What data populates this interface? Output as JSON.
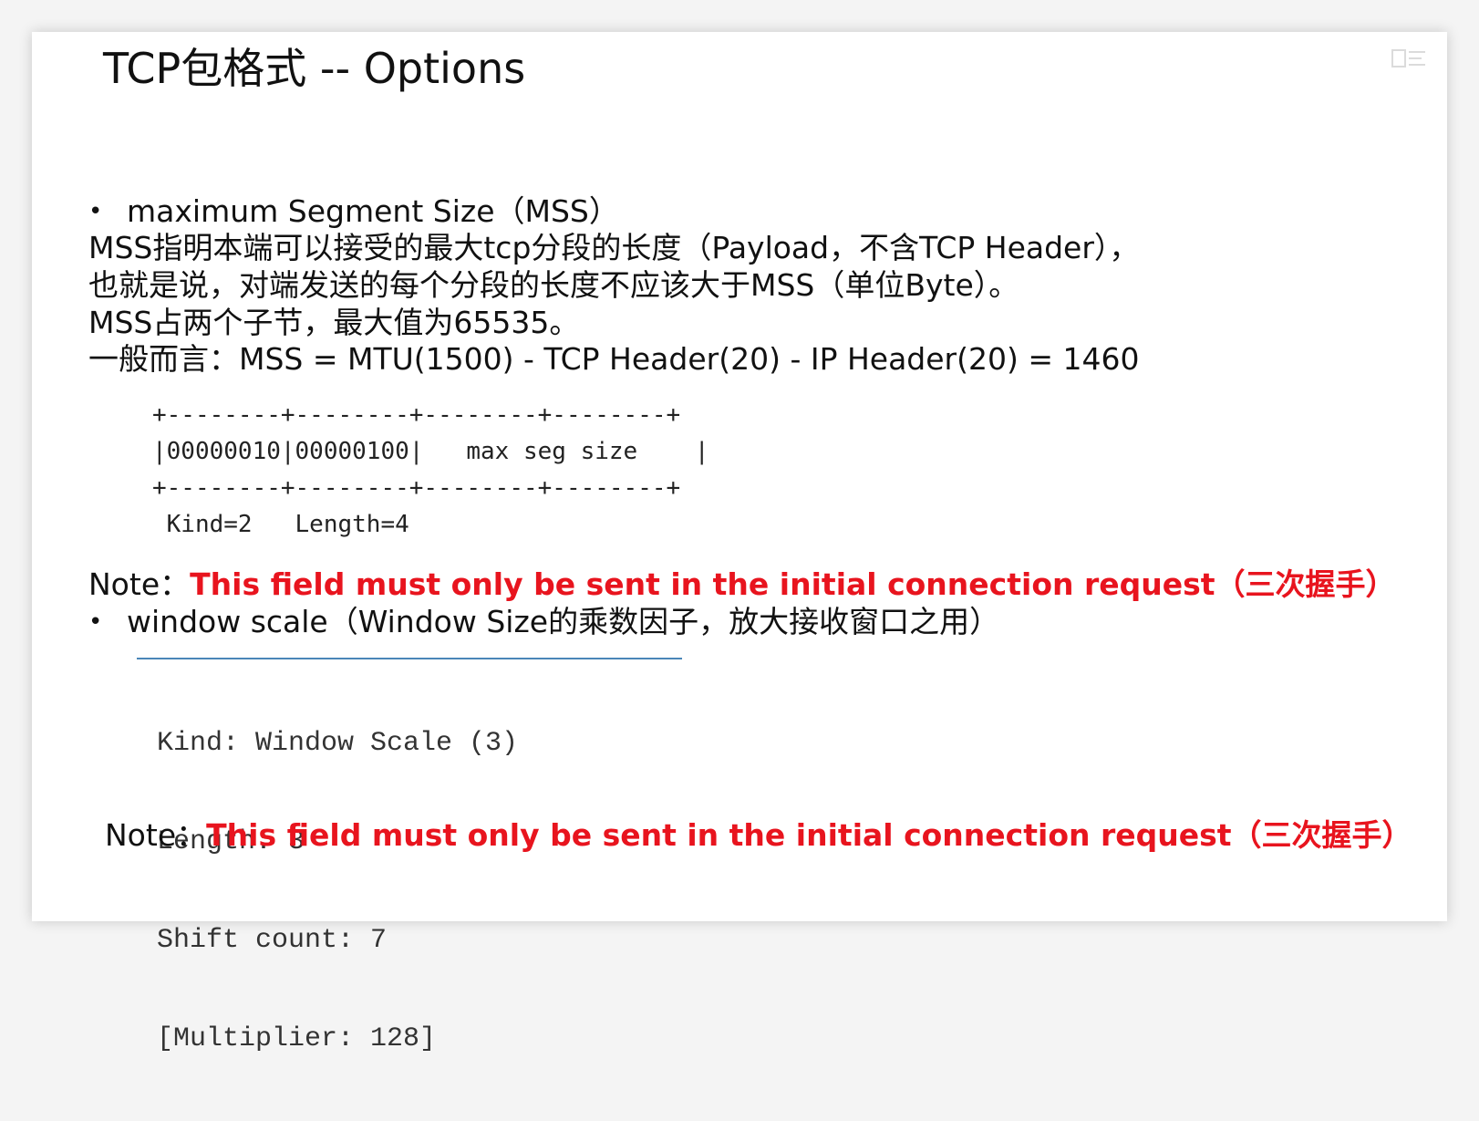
{
  "slide": {
    "title": "TCP包格式 -- Options",
    "mss_section": {
      "bullet": "•",
      "heading": "maximum Segment Size（MSS）",
      "lines": [
        "MSS指明本端可以接受的最大tcp分段的长度（Payload，不含TCP Header），",
        "也就是说，对端发送的每个分段的长度不应该大于MSS（单位Byte）。",
        "MSS占两个子节，最大值为65535。",
        "一般而言：MSS = MTU(1500) - TCP Header(20) - IP Header(20) = 1460"
      ],
      "diagram": {
        "border_top": "+--------+--------+--------+--------+",
        "row": "|00000010|00000100|   max seg size    |",
        "border_bottom": "+--------+--------+--------+--------+",
        "labels": " Kind=2   Length=4"
      },
      "note_prefix": "Note：",
      "note_text": "This field must only be sent in the initial connection request（三次握手）"
    },
    "ws_section": {
      "bullet": "•",
      "heading": "window scale（Window Size的乘数因子，放大接收窗口之用）",
      "fields": [
        "Kind: Window Scale (3)",
        "Length: 3",
        "Shift count: 7",
        "[Multiplier: 128]"
      ],
      "note_prefix": "Note：",
      "note_text": "This field must only be sent in the initial connection request（三次握手）"
    },
    "colors": {
      "note_red": "#e8141e",
      "ws_rule": "#4a86b8"
    }
  }
}
